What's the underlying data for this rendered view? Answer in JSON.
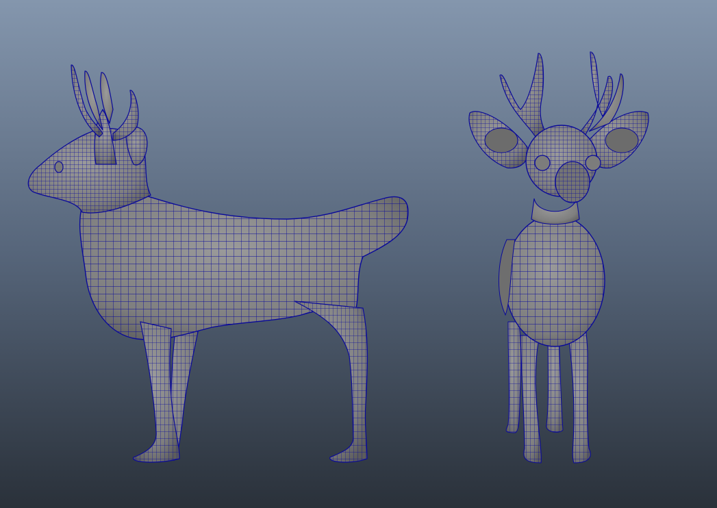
{
  "viewport": {
    "background_top": "#8496ad",
    "background_bottom": "#2a313a",
    "mesh_fill": "#858585",
    "mesh_wire": "#0a0a9a"
  },
  "models": [
    {
      "name": "deer-side-view"
    },
    {
      "name": "deer-front-view"
    }
  ]
}
